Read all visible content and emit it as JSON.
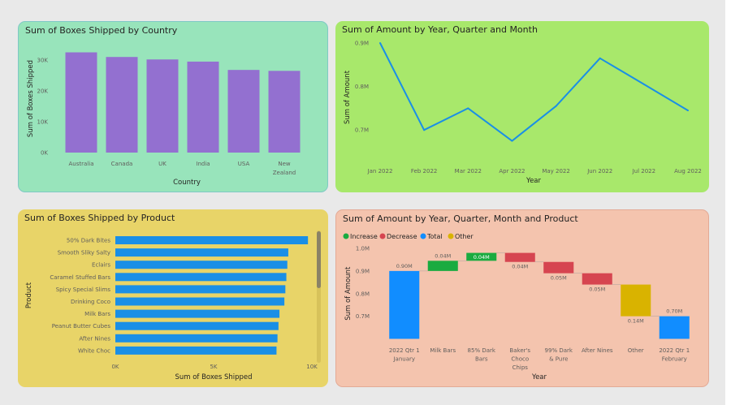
{
  "panels": {
    "country": {
      "title": "Sum of Boxes Shipped by Country",
      "bg": "#98e4bb"
    },
    "amount_line": {
      "title": "Sum of Amount by Year, Quarter and Month",
      "bg": "#a8e86b"
    },
    "product": {
      "title": "Sum of Boxes Shipped by Product",
      "bg": "#e8d468"
    },
    "waterfall": {
      "title": "Sum of Amount by Year, Quarter, Month and Product",
      "bg": "#f4c4ae"
    }
  },
  "chart_data": [
    {
      "type": "bar",
      "title": "Sum of Boxes Shipped by Country",
      "xlabel": "Country",
      "ylabel": "Sum of Boxes Shipped",
      "categories": [
        "Australia",
        "Canada",
        "UK",
        "India",
        "USA",
        "New Zealand"
      ],
      "category_lines": [
        [
          "Australia"
        ],
        [
          "Canada"
        ],
        [
          "UK"
        ],
        [
          "India"
        ],
        [
          "USA"
        ],
        [
          "New",
          "Zealand"
        ]
      ],
      "values": [
        32500,
        31000,
        30200,
        29500,
        26800,
        26500
      ],
      "ylim": [
        0,
        35000
      ],
      "yticks": [
        0,
        10000,
        20000,
        30000
      ],
      "ytick_labels": [
        "0K",
        "10K",
        "20K",
        "30K"
      ],
      "color": "#9370d0",
      "grid": false
    },
    {
      "type": "line",
      "title": "Sum of Amount by Year, Quarter and Month",
      "xlabel": "Year",
      "ylabel": "Sum of Amount",
      "x": [
        "Jan 2022",
        "Feb 2022",
        "Mar 2022",
        "Apr 2022",
        "May 2022",
        "Jun 2022",
        "Jul 2022",
        "Aug 2022"
      ],
      "values": [
        0.9,
        0.7,
        0.75,
        0.675,
        0.755,
        0.865,
        0.805,
        0.745
      ],
      "ylim": [
        0.65,
        0.9
      ],
      "yticks": [
        0.7,
        0.8,
        0.9
      ],
      "ytick_labels": [
        "0.7M",
        "0.8M",
        "0.9M"
      ],
      "color": "#1a8fe6",
      "grid": false
    },
    {
      "type": "bar",
      "orientation": "horizontal",
      "title": "Sum of Boxes Shipped by Product",
      "xlabel": "Sum of Boxes Shipped",
      "ylabel": "Product",
      "categories": [
        "50% Dark Bites",
        "Smooth Sliky Salty",
        "Eclairs",
        "Caramel Stuffed Bars",
        "Spicy Special Slims",
        "Drinking Coco",
        "Milk Bars",
        "Peanut Butter Cubes",
        "After Nines",
        "White Choc"
      ],
      "values": [
        9800,
        8800,
        8750,
        8700,
        8650,
        8600,
        8350,
        8300,
        8250,
        8200
      ],
      "xlim": [
        0,
        10000
      ],
      "xticks": [
        0,
        5000,
        10000
      ],
      "xtick_labels": [
        "0K",
        "5K",
        "10K"
      ],
      "color": "#1a8fe6",
      "grid": false
    },
    {
      "type": "waterfall",
      "title": "Sum of Amount by Year, Quarter, Month and Product",
      "xlabel": "Year",
      "ylabel": "Sum of Amount",
      "legend": [
        {
          "label": "Increase",
          "color": "#1aab40"
        },
        {
          "label": "Decrease",
          "color": "#d64550"
        },
        {
          "label": "Total",
          "color": "#118dff"
        },
        {
          "label": "Other",
          "color": "#d9b300"
        }
      ],
      "legend_position": "top-left",
      "categories": [
        "2022 Qtr 1 January",
        "Milk Bars",
        "85% Dark Bars",
        "Baker's Choco Chips",
        "99% Dark & Pure",
        "After Nines",
        "Other",
        "2022 Qtr 1 February"
      ],
      "category_lines": [
        [
          "2022 Qtr 1",
          "January"
        ],
        [
          "Milk Bars"
        ],
        [
          "85% Dark",
          "Bars"
        ],
        [
          "Baker's",
          "Choco",
          "Chips"
        ],
        [
          "99% Dark",
          "& Pure"
        ],
        [
          "After Nines"
        ],
        [
          "Other"
        ],
        [
          "2022 Qtr 1",
          "February"
        ]
      ],
      "steps": [
        {
          "kind": "total",
          "start": 0,
          "end": 0.9,
          "label": "0.90M"
        },
        {
          "kind": "increase",
          "start": 0.9,
          "end": 0.945,
          "label": "0.04M"
        },
        {
          "kind": "increase",
          "start": 0.945,
          "end": 0.98,
          "label": "0.04M"
        },
        {
          "kind": "decrease",
          "start": 0.98,
          "end": 0.94,
          "label": "0.04M"
        },
        {
          "kind": "decrease",
          "start": 0.94,
          "end": 0.89,
          "label": "0.05M"
        },
        {
          "kind": "decrease",
          "start": 0.89,
          "end": 0.84,
          "label": "0.05M"
        },
        {
          "kind": "other",
          "start": 0.84,
          "end": 0.7,
          "label": "0.14M"
        },
        {
          "kind": "total",
          "start": 0,
          "end": 0.7,
          "label": "0.70M"
        }
      ],
      "ylim": [
        0.6,
        1.0
      ],
      "yticks": [
        0.7,
        0.8,
        0.9,
        1.0
      ],
      "ytick_labels": [
        "0.7M",
        "0.8M",
        "0.9M",
        "1.0M"
      ],
      "grid": false
    }
  ]
}
